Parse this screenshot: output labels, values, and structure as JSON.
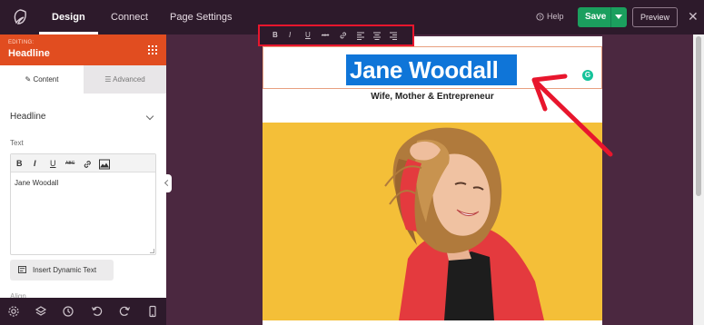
{
  "topbar": {
    "tabs": [
      {
        "label": "Design",
        "active": true
      },
      {
        "label": "Connect",
        "active": false
      },
      {
        "label": "Page Settings",
        "active": false
      }
    ],
    "help_label": "Help",
    "save_label": "Save",
    "preview_label": "Preview"
  },
  "sidebar": {
    "editing_label": "EDITING:",
    "title": "Headline",
    "tabs": [
      {
        "label": "Content",
        "icon": "edit-icon"
      },
      {
        "label": "Advanced",
        "icon": "sliders-icon"
      }
    ],
    "section_title": "Headline",
    "text_label": "Text",
    "editor_buttons": [
      "B",
      "I",
      "U",
      "ABC",
      "link",
      "image"
    ],
    "editor_value": "Jane Woodall",
    "dynamic_text_label": "Insert Dynamic Text",
    "align_label": "Align",
    "bottom_icons": [
      "settings-icon",
      "layers-icon",
      "history-icon",
      "undo-icon",
      "redo-icon",
      "mobile-icon"
    ]
  },
  "floating_toolbar": {
    "buttons": [
      "B",
      "I",
      "U",
      "ABC",
      "link",
      "align-left",
      "align-center",
      "align-right"
    ]
  },
  "canvas": {
    "headline": "Jane Woodall",
    "subheadline": "Wife, Mother & Entrepreneur",
    "grammarly_glyph": "G"
  },
  "colors": {
    "topbar_bg": "#2d1a2b",
    "canvas_bg": "#4b2840",
    "sidebar_header": "#e14d20",
    "save_button": "#1b9f5e",
    "selection": "#0f75d8",
    "annotation": "#e8162d",
    "photo_bg": "#f4bf38"
  }
}
